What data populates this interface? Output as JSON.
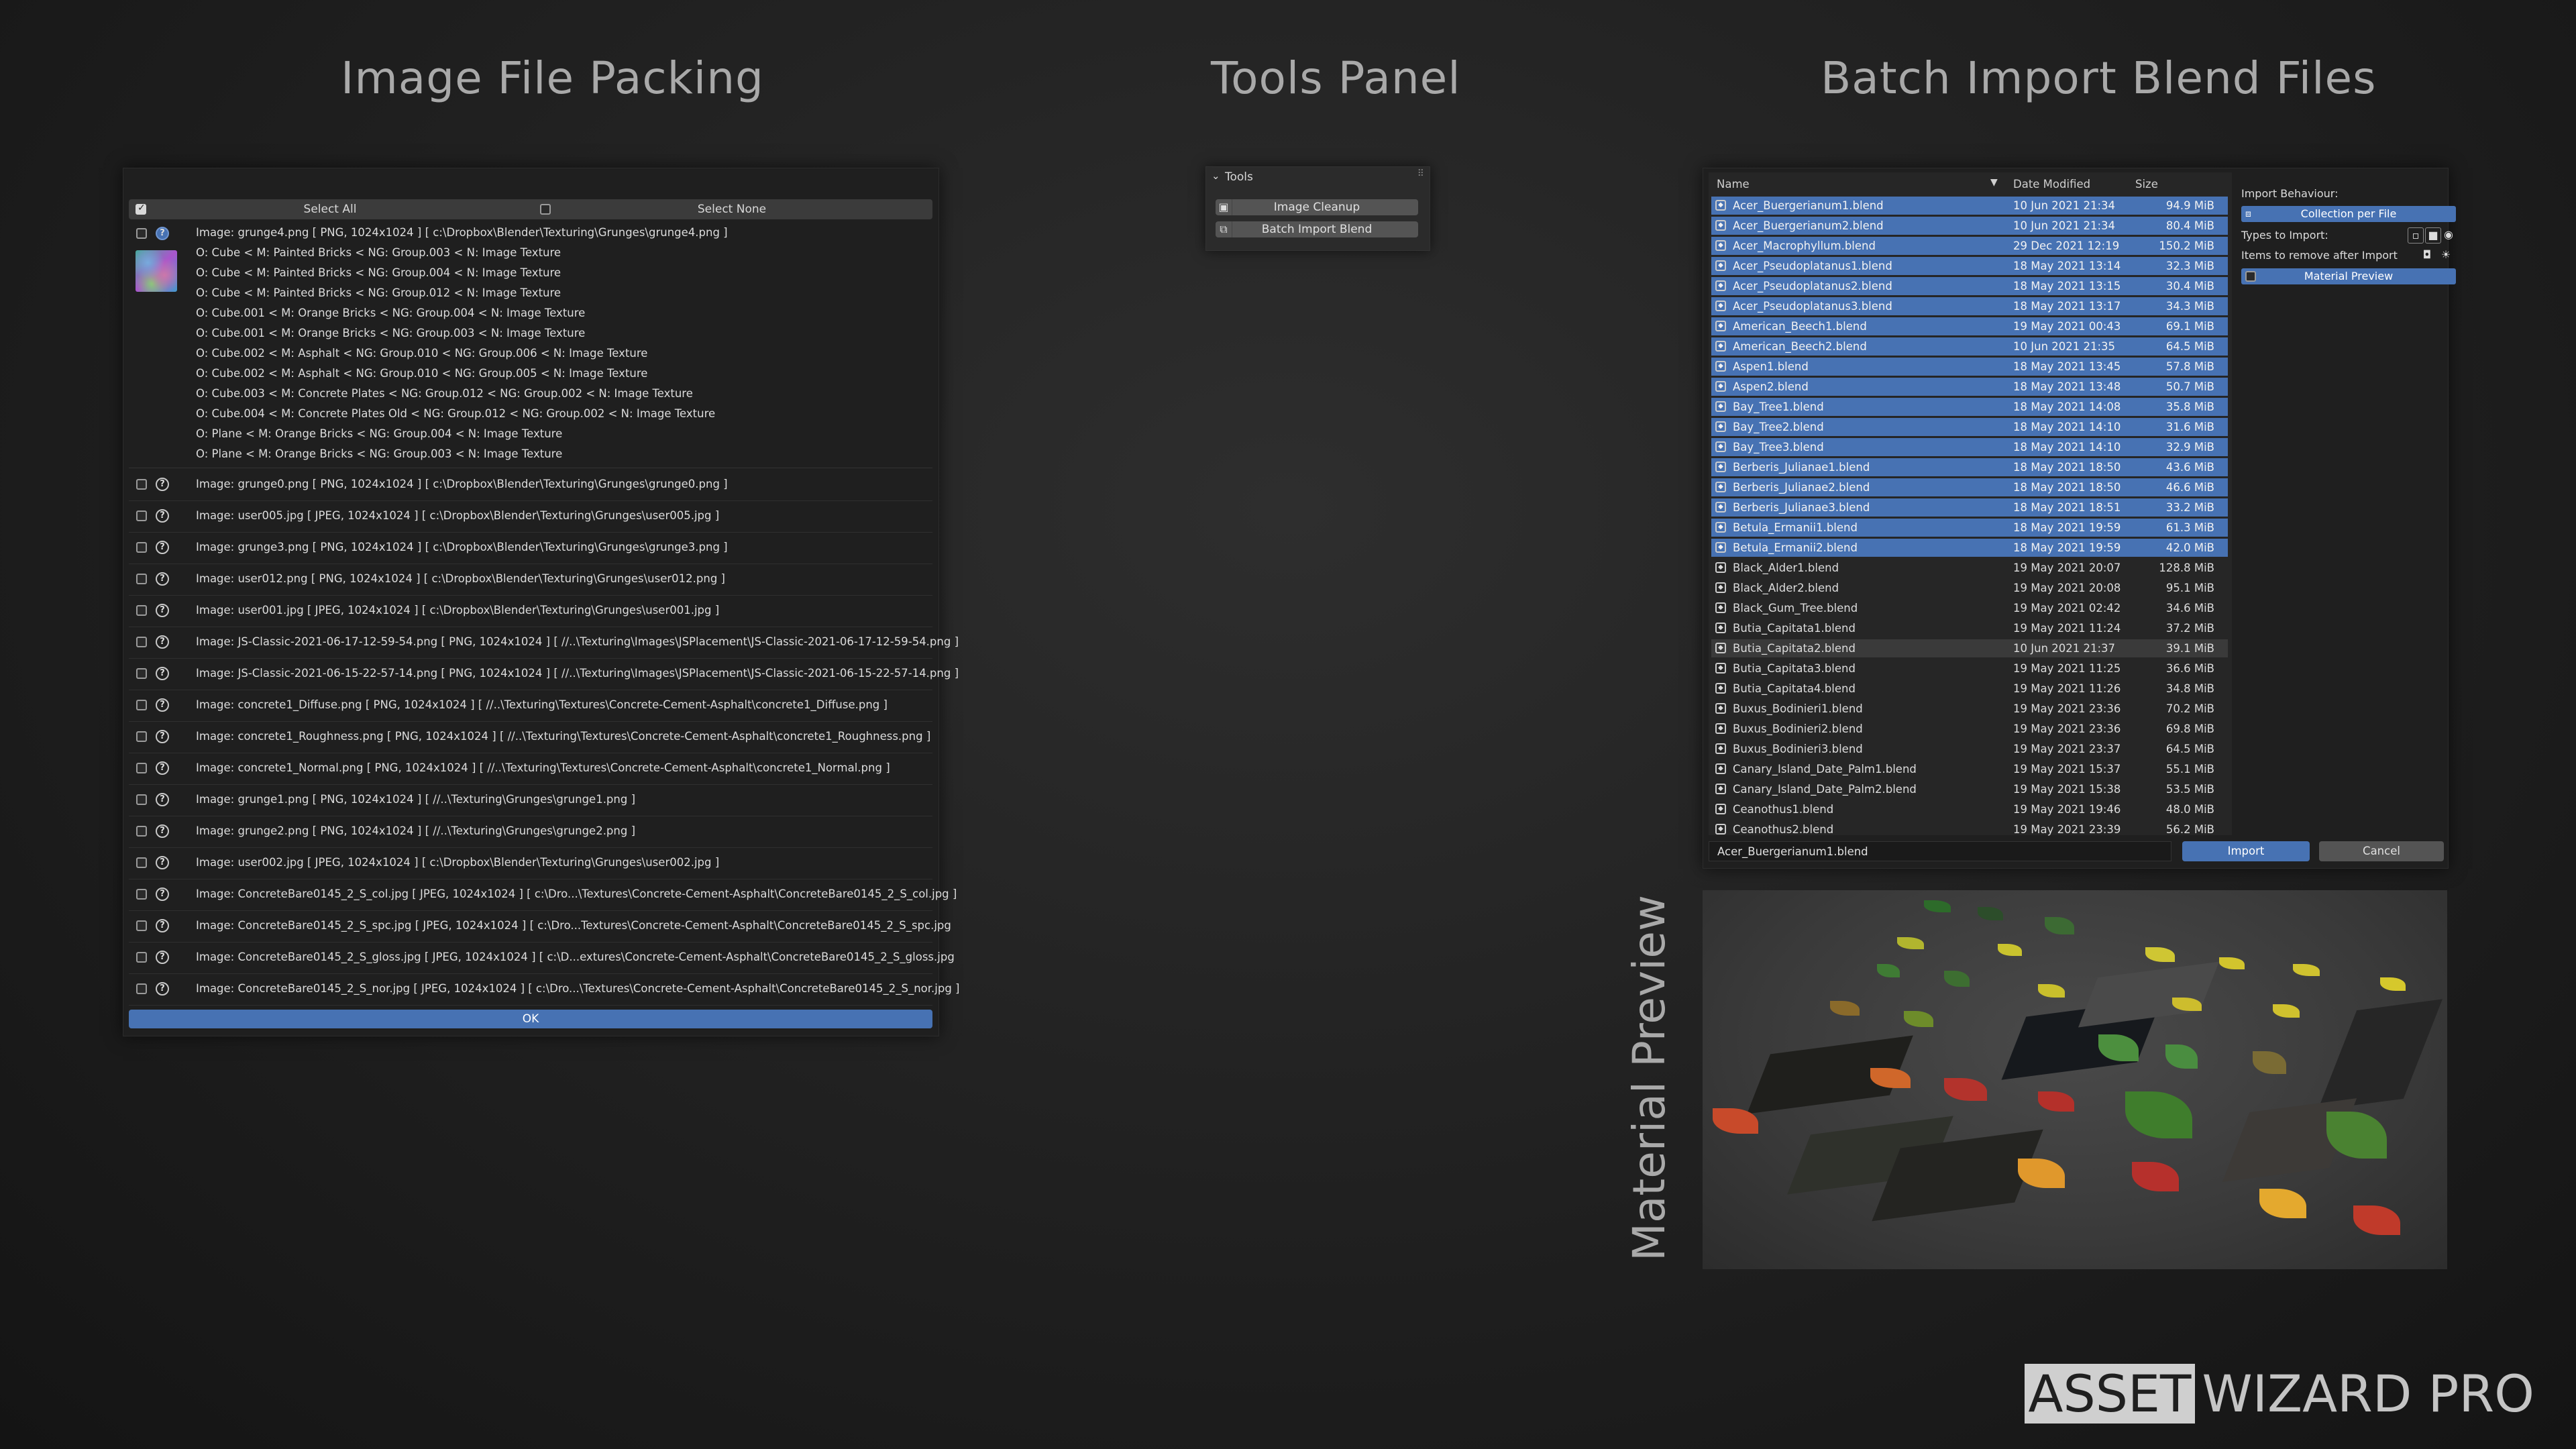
{
  "titles": {
    "image_file_packing": "Image File Packing",
    "tools_panel": "Tools Panel",
    "batch_import": "Batch Import Blend Files",
    "material_preview": "Material Preview"
  },
  "packing": {
    "select_all": "Select All",
    "select_none": "Select None",
    "first_item": {
      "image": "Image: grunge4.png [ PNG, 1024x1024 ]  [ c:\\Dropbox\\Blender\\Texturing\\Grunges\\grunge4.png ]",
      "usages": [
        "O: Cube < M: Painted Bricks < NG: Group.003 < N: Image Texture",
        "O: Cube < M: Painted Bricks < NG: Group.004 < N: Image Texture",
        "O: Cube < M: Painted Bricks < NG: Group.012 < N: Image Texture",
        "O: Cube.001 < M: Orange Bricks < NG: Group.004 < N: Image Texture",
        "O: Cube.001 < M: Orange Bricks < NG: Group.003 < N: Image Texture",
        "O: Cube.002 < M: Asphalt < NG: Group.010 < NG: Group.006 < N: Image Texture",
        "O: Cube.002 < M: Asphalt < NG: Group.010 < NG: Group.005 < N: Image Texture",
        "O: Cube.003 < M: Concrete Plates < NG: Group.012 < NG: Group.002 < N: Image Texture",
        "O: Cube.004 < M: Concrete Plates Old < NG: Group.012 < NG: Group.002 < N: Image Texture",
        "O: Plane < M: Orange Bricks < NG: Group.004 < N: Image Texture",
        "O: Plane < M: Orange Bricks < NG: Group.003 < N: Image Texture"
      ]
    },
    "rows": [
      "Image: grunge0.png [ PNG, 1024x1024 ]  [ c:\\Dropbox\\Blender\\Texturing\\Grunges\\grunge0.png ]",
      "Image: user005.jpg [ JPEG, 1024x1024 ]  [ c:\\Dropbox\\Blender\\Texturing\\Grunges\\user005.jpg ]",
      "Image: grunge3.png [ PNG, 1024x1024 ]  [ c:\\Dropbox\\Blender\\Texturing\\Grunges\\grunge3.png ]",
      "Image: user012.png [ PNG, 1024x1024 ]  [ c:\\Dropbox\\Blender\\Texturing\\Grunges\\user012.png ]",
      "Image: user001.jpg [ JPEG, 1024x1024 ]  [ c:\\Dropbox\\Blender\\Texturing\\Grunges\\user001.jpg ]",
      "Image: JS-Classic-2021-06-17-12-59-54.png [ PNG, 1024x1024 ]  [ //..\\Texturing\\Images\\JSPlacement\\JS-Classic-2021-06-17-12-59-54.png ]",
      "Image: JS-Classic-2021-06-15-22-57-14.png [ PNG, 1024x1024 ]  [ //..\\Texturing\\Images\\JSPlacement\\JS-Classic-2021-06-15-22-57-14.png ]",
      "Image: concrete1_Diffuse.png [ PNG, 1024x1024 ]  [ //..\\Texturing\\Textures\\Concrete-Cement-Asphalt\\concrete1_Diffuse.png ]",
      "Image: concrete1_Roughness.png [ PNG, 1024x1024 ]  [ //..\\Texturing\\Textures\\Concrete-Cement-Asphalt\\concrete1_Roughness.png ]",
      "Image: concrete1_Normal.png [ PNG, 1024x1024 ]  [ //..\\Texturing\\Textures\\Concrete-Cement-Asphalt\\concrete1_Normal.png ]",
      "Image: grunge1.png [ PNG, 1024x1024 ]  [ //..\\Texturing\\Grunges\\grunge1.png ]",
      "Image: grunge2.png [ PNG, 1024x1024 ]  [ //..\\Texturing\\Grunges\\grunge2.png ]",
      "Image: user002.jpg [ JPEG, 1024x1024 ]  [ c:\\Dropbox\\Blender\\Texturing\\Grunges\\user002.jpg ]",
      "Image: ConcreteBare0145_2_S_col.jpg [ JPEG, 1024x1024 ]  [ c:\\Dro...\\Textures\\Concrete-Cement-Asphalt\\ConcreteBare0145_2_S_col.jpg ]",
      "Image: ConcreteBare0145_2_S_spc.jpg [ JPEG, 1024x1024 ]  [ c:\\Dro...Textures\\Concrete-Cement-Asphalt\\ConcreteBare0145_2_S_spc.jpg",
      "Image: ConcreteBare0145_2_S_gloss.jpg [ JPEG, 1024x1024 ]  [ c:\\D...extures\\Concrete-Cement-Asphalt\\ConcreteBare0145_2_S_gloss.jpg",
      "Image: ConcreteBare0145_2_S_nor.jpg [ JPEG, 1024x1024 ]  [ c:\\Dro...\\Textures\\Concrete-Cement-Asphalt\\ConcreteBare0145_2_S_nor.jpg ]"
    ],
    "ok": "OK"
  },
  "tools": {
    "header": "Tools",
    "buttons": [
      "Image Cleanup",
      "Batch Import Blend"
    ]
  },
  "batch": {
    "columns": {
      "name": "Name",
      "date": "Date Modified",
      "size": "Size"
    },
    "files": [
      {
        "name": "Acer_Buergerianum1.blend",
        "date": "10 Jun 2021 21:34",
        "size": "94.9 MiB",
        "selected": true
      },
      {
        "name": "Acer_Buergerianum2.blend",
        "date": "10 Jun 2021 21:34",
        "size": "80.4 MiB",
        "selected": true
      },
      {
        "name": "Acer_Macrophyllum.blend",
        "date": "29 Dec 2021 12:19",
        "size": "150.2 MiB",
        "selected": true
      },
      {
        "name": "Acer_Pseudoplatanus1.blend",
        "date": "18 May 2021 13:14",
        "size": "32.3 MiB",
        "selected": true
      },
      {
        "name": "Acer_Pseudoplatanus2.blend",
        "date": "18 May 2021 13:15",
        "size": "30.4 MiB",
        "selected": true
      },
      {
        "name": "Acer_Pseudoplatanus3.blend",
        "date": "18 May 2021 13:17",
        "size": "34.3 MiB",
        "selected": true
      },
      {
        "name": "American_Beech1.blend",
        "date": "19 May 2021 00:43",
        "size": "69.1 MiB",
        "selected": true
      },
      {
        "name": "American_Beech2.blend",
        "date": "10 Jun 2021 21:35",
        "size": "64.5 MiB",
        "selected": true
      },
      {
        "name": "Aspen1.blend",
        "date": "18 May 2021 13:45",
        "size": "57.8 MiB",
        "selected": true
      },
      {
        "name": "Aspen2.blend",
        "date": "18 May 2021 13:48",
        "size": "50.7 MiB",
        "selected": true
      },
      {
        "name": "Bay_Tree1.blend",
        "date": "18 May 2021 14:08",
        "size": "35.8 MiB",
        "selected": true
      },
      {
        "name": "Bay_Tree2.blend",
        "date": "18 May 2021 14:10",
        "size": "31.6 MiB",
        "selected": true
      },
      {
        "name": "Bay_Tree3.blend",
        "date": "18 May 2021 14:10",
        "size": "32.9 MiB",
        "selected": true
      },
      {
        "name": "Berberis_Julianae1.blend",
        "date": "18 May 2021 18:50",
        "size": "43.6 MiB",
        "selected": true
      },
      {
        "name": "Berberis_Julianae2.blend",
        "date": "18 May 2021 18:50",
        "size": "46.6 MiB",
        "selected": true
      },
      {
        "name": "Berberis_Julianae3.blend",
        "date": "18 May 2021 18:51",
        "size": "33.2 MiB",
        "selected": true
      },
      {
        "name": "Betula_Ermanii1.blend",
        "date": "18 May 2021 19:59",
        "size": "61.3 MiB",
        "selected": true
      },
      {
        "name": "Betula_Ermanii2.blend",
        "date": "18 May 2021 19:59",
        "size": "42.0 MiB",
        "selected": true
      },
      {
        "name": "Black_Alder1.blend",
        "date": "19 May 2021 20:07",
        "size": "128.8 MiB",
        "selected": false
      },
      {
        "name": "Black_Alder2.blend",
        "date": "19 May 2021 20:08",
        "size": "95.1 MiB",
        "selected": false
      },
      {
        "name": "Black_Gum_Tree.blend",
        "date": "19 May 2021 02:42",
        "size": "34.6 MiB",
        "selected": false
      },
      {
        "name": "Butia_Capitata1.blend",
        "date": "19 May 2021 11:24",
        "size": "37.2 MiB",
        "selected": false
      },
      {
        "name": "Butia_Capitata2.blend",
        "date": "10 Jun 2021 21:37",
        "size": "39.1 MiB",
        "selected": false,
        "highlight": true
      },
      {
        "name": "Butia_Capitata3.blend",
        "date": "19 May 2021 11:25",
        "size": "36.6 MiB",
        "selected": false
      },
      {
        "name": "Butia_Capitata4.blend",
        "date": "19 May 2021 11:26",
        "size": "34.8 MiB",
        "selected": false
      },
      {
        "name": "Buxus_Bodinieri1.blend",
        "date": "19 May 2021 23:36",
        "size": "70.2 MiB",
        "selected": false
      },
      {
        "name": "Buxus_Bodinieri2.blend",
        "date": "19 May 2021 23:36",
        "size": "69.8 MiB",
        "selected": false
      },
      {
        "name": "Buxus_Bodinieri3.blend",
        "date": "19 May 2021 23:37",
        "size": "64.5 MiB",
        "selected": false
      },
      {
        "name": "Canary_Island_Date_Palm1.blend",
        "date": "19 May 2021 15:37",
        "size": "55.1 MiB",
        "selected": false
      },
      {
        "name": "Canary_Island_Date_Palm2.blend",
        "date": "19 May 2021 15:38",
        "size": "53.5 MiB",
        "selected": false
      },
      {
        "name": "Ceanothus1.blend",
        "date": "19 May 2021 19:46",
        "size": "48.0 MiB",
        "selected": false
      },
      {
        "name": "Ceanothus2.blend",
        "date": "19 May 2021 23:39",
        "size": "56.2 MiB",
        "selected": false
      }
    ],
    "options": {
      "import_behaviour_label": "Import Behaviour:",
      "import_behaviour_value": "Collection per File",
      "types_label": "Types to Import:",
      "remove_label": "Items to remove after Import",
      "material_preview": "Material Preview"
    },
    "filename": "Acer_Buergerianum1.blend",
    "import": "Import",
    "cancel": "Cancel"
  },
  "logo": {
    "boxed": "ASSET",
    "rest": "WIZARD PRO"
  },
  "colors": {
    "accent": "#4772b3",
    "background": "#1f1f1f"
  }
}
